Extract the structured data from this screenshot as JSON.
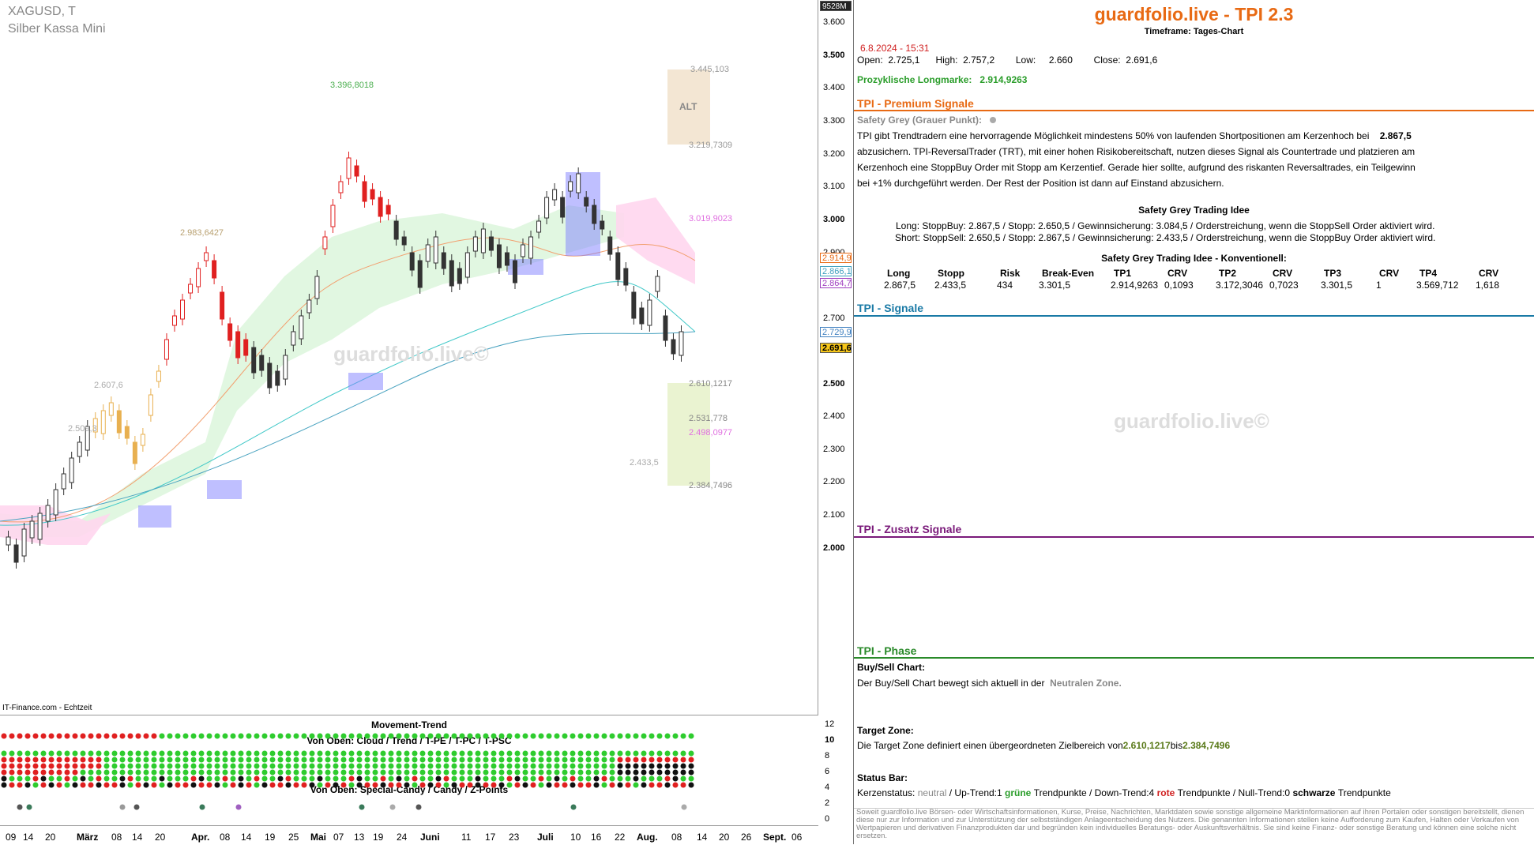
{
  "chart": {
    "symbol": "XAGUSD, T",
    "name": "Silber Kassa Mini",
    "source": "IT-Finance.com - Echtzeit",
    "watermark": "guardfolio.live©",
    "badge": "9528M",
    "alt_label": "ALT",
    "price_labels": [
      "3.445,103",
      "3.219,7309",
      "3.396,8018",
      "3.019,9023",
      "2.983,6427",
      "2.607,6",
      "2.509,3",
      "2.610,1217",
      "2.531,778",
      "2.498,0977",
      "2.433,5",
      "2.384,7496"
    ],
    "y_ticks": [
      "3.600",
      "3.500",
      "3.400",
      "3.300",
      "3.200",
      "3.100",
      "3.000",
      "2.900",
      "2.800",
      "2.700",
      "2.600",
      "2.500",
      "2.400",
      "2.300",
      "2.200",
      "2.100",
      "2.000"
    ],
    "tags": [
      "2.914,9",
      "2.866,1",
      "2.864,7",
      "2.729,9",
      "2.691,6"
    ],
    "x_ticks": [
      "09",
      "14",
      "20",
      "März",
      "08",
      "14",
      "20",
      "Apr.",
      "08",
      "14",
      "19",
      "25",
      "Mai",
      "07",
      "13",
      "19",
      "24",
      "Juni",
      "11",
      "17",
      "23",
      "Juli",
      "10",
      "16",
      "22",
      "Aug.",
      "08",
      "14",
      "20",
      "26",
      "Sept.",
      "06"
    ],
    "colors": {
      "up": "#1a1a1a",
      "down": "#e02020",
      "cloud": "#c8f0c8",
      "pinkcloud": "#ffd0ee"
    }
  },
  "indicator": {
    "title1": "Movement-Trend",
    "title2": "Von Oben: Cloud / Trend / T-PE / T-PC / T-PSC",
    "title3": "Von Oben: Special-Candy / Candy / Z-Points",
    "y_ticks": [
      "12",
      "10",
      "8",
      "6",
      "4",
      "2",
      "0"
    ]
  },
  "panel": {
    "title": "guardfolio.live - TPI 2.3",
    "timeframe": "Timeframe: Tages-Chart",
    "datetime": "6.8.2024 - 15:31",
    "open_label": "Open:",
    "open": "2.725,1",
    "high_label": "High:",
    "high": "2.757,2",
    "low_label": "Low:",
    "low": "2.660",
    "close_label": "Close:",
    "close": "2.691,6",
    "longmark_label": "Prozyklische Longmarke:",
    "longmark": "2.914,9263",
    "premium_title": "TPI - Premium Signale",
    "safety_label": "Safety Grey (Grauer Punkt):",
    "premium_text1": "TPI gibt Trendtradern eine hervorragende Möglichkeit mindestens 50% von laufenden Shortpositionen am Kerzenhoch bei",
    "premium_value": "2.867,5",
    "premium_text2": "abzusichern. TPI-ReversalTrader (TRT), mit einer hohen Risikobereitschaft, nutzen dieses Signal als Countertrade und platzieren am",
    "premium_text3": "Kerzenhoch eine StoppBuy Order mit Stopp am Kerzentief. Gerade hier sollte, aufgrund des riskanten Reversaltrades, ein Teilgewinn",
    "premium_text4": "bei +1% durchgeführt werden. Der Rest der Position ist dann auf Einstand abzusichern.",
    "idea_title": "Safety Grey Trading Idee",
    "idea_long": "Long: StoppBuy:   2.867,5  / Stopp:  2.650,5  / Gewinnsicherung: 3.084,5   / Orderstreichung, wenn die StoppSell Order aktiviert wird.",
    "idea_short": "Short: StoppSell:   2.650,5  / Stopp:  2.867,5  / Gewinnsicherung: 2.433,5   / Orderstreichung, wenn die StoppBuy Order aktiviert wird.",
    "konv_title": "Safety Grey Trading Idee - Konventionell:",
    "konv_headers": [
      "Long",
      "Stopp",
      "Risk",
      "Break-Even",
      "TP1",
      "CRV",
      "TP2",
      "CRV",
      "TP3",
      "CRV",
      "TP4",
      "CRV"
    ],
    "konv_values": [
      "2.867,5",
      "2.433,5",
      "434",
      "3.301,5",
      "2.914,9263",
      "0,1093",
      "3.172,3046",
      "0,7023",
      "3.301,5",
      "1",
      "3.569,712",
      "1,618"
    ],
    "signale_title": "TPI - Signale",
    "watermark": "guardfolio.live©",
    "zusatz_title": "TPI - Zusatz Signale",
    "phase_title": "TPI - Phase",
    "buysell_label": "Buy/Sell Chart:",
    "buysell_text": "Der Buy/Sell Chart bewegt sich aktuell in der",
    "buysell_zone": "Neutralen Zone.",
    "target_label": "Target Zone:",
    "target_text": "Die Target Zone definiert einen übergeordneten Zielbereich von",
    "target_from": "2.610,1217",
    "target_bis": "bis",
    "target_to": "2.384,7496",
    "status_label": "Status Bar:",
    "status_k": "Kerzenstatus:",
    "status_neutral": "neutral",
    "status_up": " / Up-Trend:1",
    "status_gruene": "grüne",
    "status_tp1": "Trendpunkte  / Down-Trend:4",
    "status_rote": "rote",
    "status_tp2": "Trendpunkte  / Null-Trend:0",
    "status_schwarze": "schwarze",
    "status_tp3": "Trendpunkte",
    "disclaimer": "Soweit guardfolio.live Börsen- oder Wirtschaftsinformationen, Kurse, Preise, Nachrichten, Marktdaten sowie sonstige allgemeine Marktinformationen auf ihren Portalen oder sonstigen bereitstellt, dienen diese nur zur Information und zur Unterstützung der selbstständigen Anlageentscheidung des Nutzers. Die genannten Informationen stellen keine Aufforderung zum Kaufen, Halten oder Verkaufen von Wertpapieren und derivativen Finanzprodukten dar und begründen kein individuelles Beratungs- oder Auskunftsverhältnis. Sie sind keine Finanz- oder sonstige Beratung und können eine solche nicht ersetzen."
  }
}
